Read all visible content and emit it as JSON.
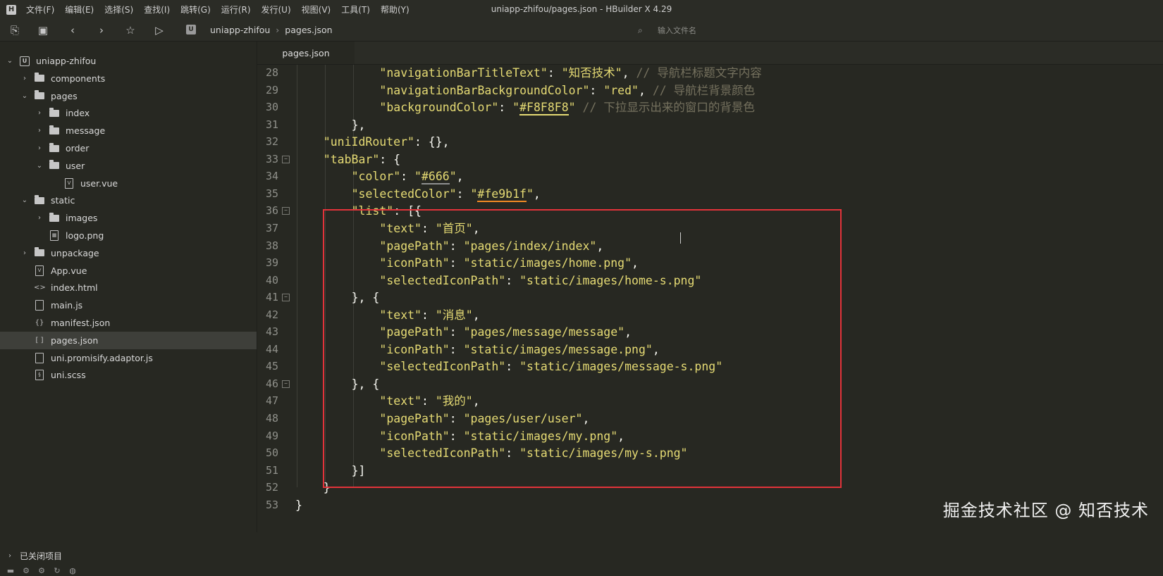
{
  "menubar": {
    "items": [
      "文件(F)",
      "编辑(E)",
      "选择(S)",
      "查找(I)",
      "跳转(G)",
      "运行(R)",
      "发行(U)",
      "视图(V)",
      "工具(T)",
      "帮助(Y)"
    ],
    "title": "uniapp-zhifou/pages.json - HBuilder X 4.29"
  },
  "toolbar": {
    "breadcrumb": [
      "uniapp-zhifou",
      "pages.json"
    ],
    "search_placeholder": "输入文件名"
  },
  "sidebar": {
    "tree": [
      {
        "label": "uniapp-zhifou",
        "depth": 0,
        "type": "project",
        "expanded": true
      },
      {
        "label": "components",
        "depth": 1,
        "type": "folder",
        "expanded": false
      },
      {
        "label": "pages",
        "depth": 1,
        "type": "folder",
        "expanded": true
      },
      {
        "label": "index",
        "depth": 2,
        "type": "folder",
        "expanded": false
      },
      {
        "label": "message",
        "depth": 2,
        "type": "folder",
        "expanded": false
      },
      {
        "label": "order",
        "depth": 2,
        "type": "folder",
        "expanded": false
      },
      {
        "label": "user",
        "depth": 2,
        "type": "folder",
        "expanded": true
      },
      {
        "label": "user.vue",
        "depth": 3,
        "type": "vue"
      },
      {
        "label": "static",
        "depth": 1,
        "type": "folder",
        "expanded": true
      },
      {
        "label": "images",
        "depth": 2,
        "type": "folder",
        "expanded": false
      },
      {
        "label": "logo.png",
        "depth": 2,
        "type": "image"
      },
      {
        "label": "unpackage",
        "depth": 1,
        "type": "folder",
        "expanded": false
      },
      {
        "label": "App.vue",
        "depth": 1,
        "type": "vue"
      },
      {
        "label": "index.html",
        "depth": 1,
        "type": "html"
      },
      {
        "label": "main.js",
        "depth": 1,
        "type": "js"
      },
      {
        "label": "manifest.json",
        "depth": 1,
        "type": "manifest"
      },
      {
        "label": "pages.json",
        "depth": 1,
        "type": "json",
        "selected": true
      },
      {
        "label": "uni.promisify.adaptor.js",
        "depth": 1,
        "type": "js"
      },
      {
        "label": "uni.scss",
        "depth": 1,
        "type": "scss"
      }
    ],
    "closed_projects": "已关闭项目"
  },
  "editor": {
    "tab": "pages.json",
    "lines": [
      {
        "n": "28",
        "fold": false,
        "indent": 3,
        "parts": [
          [
            "s",
            "\"navigationBarTitleText\""
          ],
          [
            "p",
            ": "
          ],
          [
            "s",
            "\"知否技术\""
          ],
          [
            "p",
            ", "
          ],
          [
            "c",
            "// 导航栏标题文字内容"
          ]
        ]
      },
      {
        "n": "29",
        "fold": false,
        "indent": 3,
        "parts": [
          [
            "s",
            "\"navigationBarBackgroundColor\""
          ],
          [
            "p",
            ": "
          ],
          [
            "s",
            "\"red\""
          ],
          [
            "p",
            ", "
          ],
          [
            "c",
            "// 导航栏背景颜色"
          ]
        ]
      },
      {
        "n": "30",
        "fold": false,
        "indent": 3,
        "parts": [
          [
            "s",
            "\"backgroundColor\""
          ],
          [
            "p",
            ": "
          ],
          [
            "s",
            "\""
          ],
          [
            "s-ulh",
            "#F8F8F8"
          ],
          [
            "s",
            "\""
          ],
          [
            "p",
            " "
          ],
          [
            "c",
            "// 下拉显示出来的窗口的背景色"
          ]
        ]
      },
      {
        "n": "31",
        "fold": false,
        "indent": 2,
        "parts": [
          [
            "p",
            "},"
          ]
        ]
      },
      {
        "n": "32",
        "fold": false,
        "indent": 1,
        "parts": [
          [
            "s",
            "\"uniIdRouter\""
          ],
          [
            "p",
            ": {},"
          ]
        ]
      },
      {
        "n": "33",
        "fold": true,
        "indent": 1,
        "parts": [
          [
            "s",
            "\"tabBar\""
          ],
          [
            "p",
            ": {"
          ]
        ]
      },
      {
        "n": "34",
        "fold": false,
        "indent": 2,
        "parts": [
          [
            "s",
            "\"color\""
          ],
          [
            "p",
            ": "
          ],
          [
            "s",
            "\""
          ],
          [
            "s-ulg",
            "#666"
          ],
          [
            "s",
            "\""
          ],
          [
            "p",
            ","
          ]
        ]
      },
      {
        "n": "35",
        "fold": false,
        "indent": 2,
        "parts": [
          [
            "s",
            "\"selectedColor\""
          ],
          [
            "p",
            ": "
          ],
          [
            "s",
            "\""
          ],
          [
            "s-ulo",
            "#fe9b1f"
          ],
          [
            "s",
            "\""
          ],
          [
            "p",
            ","
          ]
        ]
      },
      {
        "n": "36",
        "fold": true,
        "indent": 2,
        "parts": [
          [
            "s",
            "\"list\""
          ],
          [
            "p",
            ": [{"
          ]
        ]
      },
      {
        "n": "37",
        "fold": false,
        "indent": 3,
        "parts": [
          [
            "s",
            "\"text\""
          ],
          [
            "p",
            ": "
          ],
          [
            "s",
            "\"首页\""
          ],
          [
            "p",
            ","
          ]
        ]
      },
      {
        "n": "38",
        "fold": false,
        "indent": 3,
        "parts": [
          [
            "s",
            "\"pagePath\""
          ],
          [
            "p",
            ": "
          ],
          [
            "s",
            "\"pages/index/index\""
          ],
          [
            "p",
            ","
          ]
        ]
      },
      {
        "n": "39",
        "fold": false,
        "indent": 3,
        "parts": [
          [
            "s",
            "\"iconPath\""
          ],
          [
            "p",
            ": "
          ],
          [
            "s",
            "\"static/images/home.png\""
          ],
          [
            "p",
            ","
          ]
        ]
      },
      {
        "n": "40",
        "fold": false,
        "indent": 3,
        "parts": [
          [
            "s",
            "\"selectedIconPath\""
          ],
          [
            "p",
            ": "
          ],
          [
            "s",
            "\"static/images/home-s.png\""
          ]
        ]
      },
      {
        "n": "41",
        "fold": true,
        "indent": 2,
        "parts": [
          [
            "p",
            "}, {"
          ]
        ]
      },
      {
        "n": "42",
        "fold": false,
        "indent": 3,
        "parts": [
          [
            "s",
            "\"text\""
          ],
          [
            "p",
            ": "
          ],
          [
            "s",
            "\"消息\""
          ],
          [
            "p",
            ","
          ]
        ]
      },
      {
        "n": "43",
        "fold": false,
        "indent": 3,
        "parts": [
          [
            "s",
            "\"pagePath\""
          ],
          [
            "p",
            ": "
          ],
          [
            "s",
            "\"pages/message/message\""
          ],
          [
            "p",
            ","
          ]
        ]
      },
      {
        "n": "44",
        "fold": false,
        "indent": 3,
        "parts": [
          [
            "s",
            "\"iconPath\""
          ],
          [
            "p",
            ": "
          ],
          [
            "s",
            "\"static/images/message.png\""
          ],
          [
            "p",
            ","
          ]
        ]
      },
      {
        "n": "45",
        "fold": false,
        "indent": 3,
        "parts": [
          [
            "s",
            "\"selectedIconPath\""
          ],
          [
            "p",
            ": "
          ],
          [
            "s",
            "\"static/images/message-s.png\""
          ]
        ]
      },
      {
        "n": "46",
        "fold": true,
        "indent": 2,
        "parts": [
          [
            "p",
            "}, {"
          ]
        ]
      },
      {
        "n": "47",
        "fold": false,
        "indent": 3,
        "parts": [
          [
            "s",
            "\"text\""
          ],
          [
            "p",
            ": "
          ],
          [
            "s",
            "\"我的\""
          ],
          [
            "p",
            ","
          ]
        ]
      },
      {
        "n": "48",
        "fold": false,
        "indent": 3,
        "parts": [
          [
            "s",
            "\"pagePath\""
          ],
          [
            "p",
            ": "
          ],
          [
            "s",
            "\"pages/user/user\""
          ],
          [
            "p",
            ","
          ]
        ]
      },
      {
        "n": "49",
        "fold": false,
        "indent": 3,
        "parts": [
          [
            "s",
            "\"iconPath\""
          ],
          [
            "p",
            ": "
          ],
          [
            "s",
            "\"static/images/my.png\""
          ],
          [
            "p",
            ","
          ]
        ]
      },
      {
        "n": "50",
        "fold": false,
        "indent": 3,
        "parts": [
          [
            "s",
            "\"selectedIconPath\""
          ],
          [
            "p",
            ": "
          ],
          [
            "s",
            "\"static/images/my-s.png\""
          ]
        ]
      },
      {
        "n": "51",
        "fold": false,
        "indent": 2,
        "parts": [
          [
            "p",
            "}]"
          ]
        ]
      },
      {
        "n": "52",
        "fold": false,
        "indent": 1,
        "parts": [
          [
            "p",
            "}"
          ]
        ]
      },
      {
        "n": "53",
        "fold": false,
        "indent": 0,
        "parts": [
          [
            "p",
            "}"
          ]
        ]
      }
    ]
  },
  "watermark": "掘金技术社区 @ 知否技术",
  "colors": {
    "editor_bg": "#272822",
    "string": "#e6db74",
    "comment": "#75715e",
    "highlight_box": "#e2333a",
    "underline_orange": "#f08a24"
  }
}
